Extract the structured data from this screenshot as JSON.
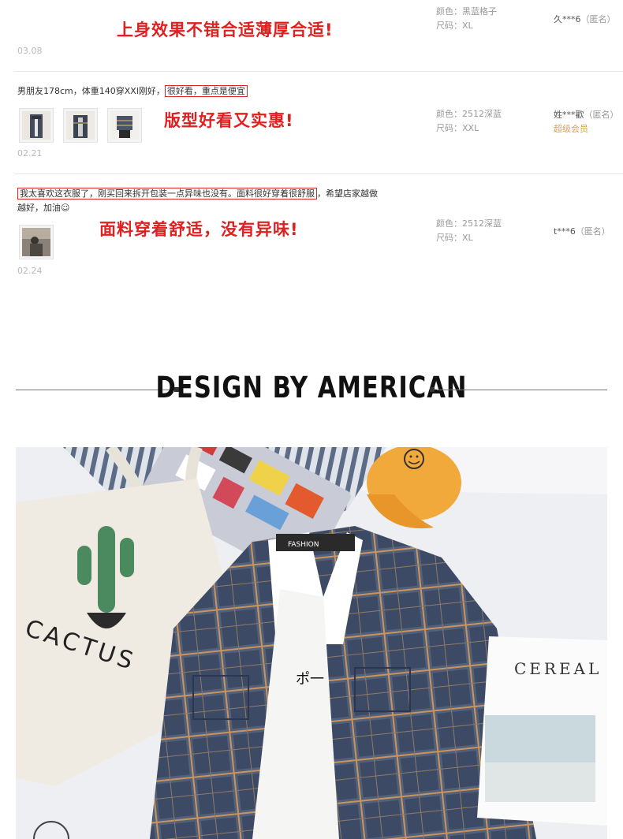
{
  "reviews": [
    {
      "overlay": "上身效果不错合适薄厚合适!",
      "date": "03.08",
      "color_label": "颜色：",
      "color_value": "黑蓝格子",
      "size_label": "尺码：",
      "size_value": "XL",
      "user": "久***6",
      "anon": "（匿名）"
    },
    {
      "text_plain": "男朋友178cm，体重140穿XXl刚好，",
      "text_boxed": "很好看，重点是便宜",
      "overlay": "版型好看又实惠!",
      "date": "02.21",
      "color_label": "颜色：",
      "color_value": "2512深蓝",
      "size_label": "尺码：",
      "size_value": "XXL",
      "user": "姓***歡",
      "anon": "（匿名）",
      "badge": "超级会员"
    },
    {
      "text_boxed": "我太喜欢这衣服了，刚买回来拆开包装一点异味也没有。面料很好穿着很舒服",
      "text_rest": "，希望店家越做",
      "text_line2": "越好，加油☺",
      "overlay": "面料穿着舒适，没有异味!",
      "date": "02.24",
      "color_label": "颜色：",
      "color_value": "2512深蓝",
      "size_label": "尺码：",
      "size_value": "XL",
      "user": "t***6",
      "anon": "（匿名）"
    }
  ],
  "section_heading": "DESIGN BY AMERICAN",
  "photo_text": {
    "cactus": "CACTUS",
    "cereal": "CEREAL",
    "fashion_label": "FASHION",
    "shirt_glyph": "ポ一"
  },
  "colors": {
    "accent_red": "#e02020",
    "vip_gold": "#d8a14a",
    "shirt_navy": "#3d4a66",
    "cap_orange": "#f2a93b"
  }
}
